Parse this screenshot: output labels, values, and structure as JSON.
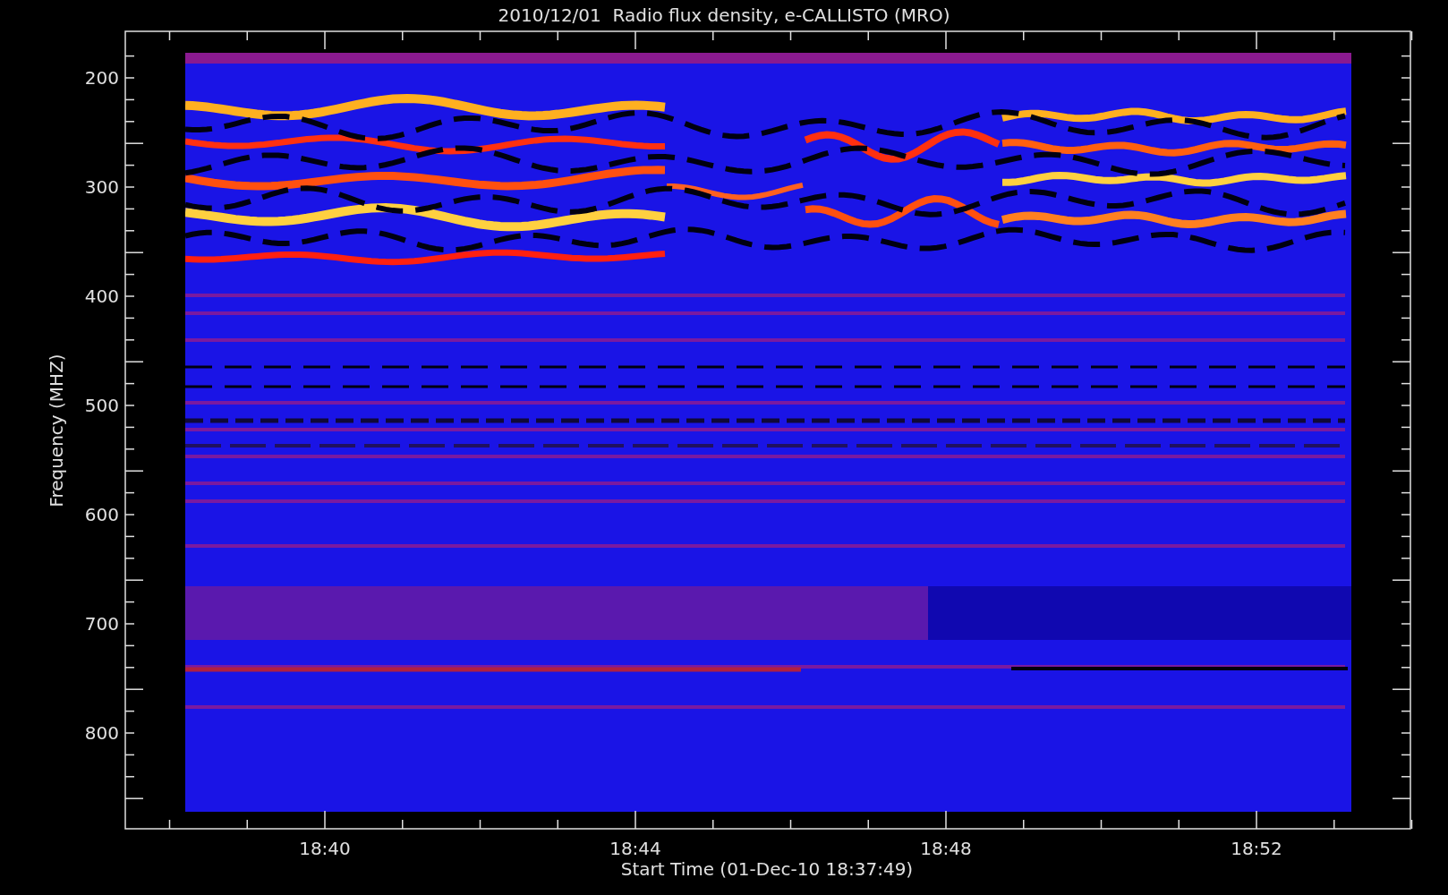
{
  "plot": {
    "title": "2010/12/01  Radio flux density, e-CALLISTO (MRO)",
    "xlabel": "Start Time (01-Dec-10 18:37:49)",
    "ylabel": "Frequency (MHZ)",
    "y_tick_labels": [
      "200",
      "300",
      "400",
      "500",
      "600",
      "700",
      "800"
    ],
    "x_tick_labels": [
      "18:40",
      "18:44",
      "18:48",
      "18:52"
    ]
  }
}
